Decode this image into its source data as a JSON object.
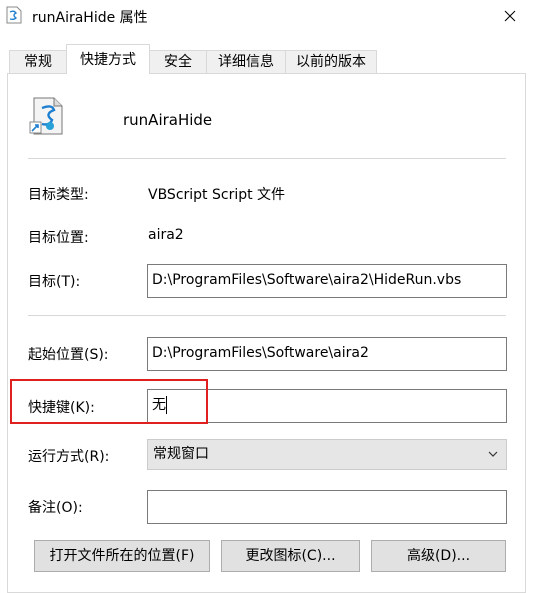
{
  "window": {
    "title": "runAiraHide 属性"
  },
  "icons": {
    "app": "script-file-icon",
    "close": "close-icon",
    "file": "vbscript-shortcut-icon",
    "dropdown": "chevron-down-icon"
  },
  "tabs": [
    {
      "label": "常规",
      "active": false
    },
    {
      "label": "快捷方式",
      "active": true
    },
    {
      "label": "安全",
      "active": false
    },
    {
      "label": "详细信息",
      "active": false
    },
    {
      "label": "以前的版本",
      "active": false
    }
  ],
  "shortcut": {
    "name": "runAiraHide",
    "target_type_label": "目标类型:",
    "target_type": "VBScript Script 文件",
    "target_location_label": "目标位置:",
    "target_location": "aira2",
    "target_label": "目标(T):",
    "target": "D:\\ProgramFiles\\Software\\aira2\\HideRun.vbs",
    "start_in_label": "起始位置(S):",
    "start_in": "D:\\ProgramFiles\\Software\\aira2",
    "hotkey_label": "快捷键(K):",
    "hotkey": "无",
    "run_label": "运行方式(R):",
    "run_mode": "常规窗口",
    "comment_label": "备注(O):",
    "comment": ""
  },
  "buttons": {
    "open_location": "打开文件所在的位置(F)",
    "change_icon": "更改图标(C)...",
    "advanced": "高级(D)..."
  },
  "colors": {
    "highlight": "#e0201e",
    "accent": "#1e7fd0"
  }
}
